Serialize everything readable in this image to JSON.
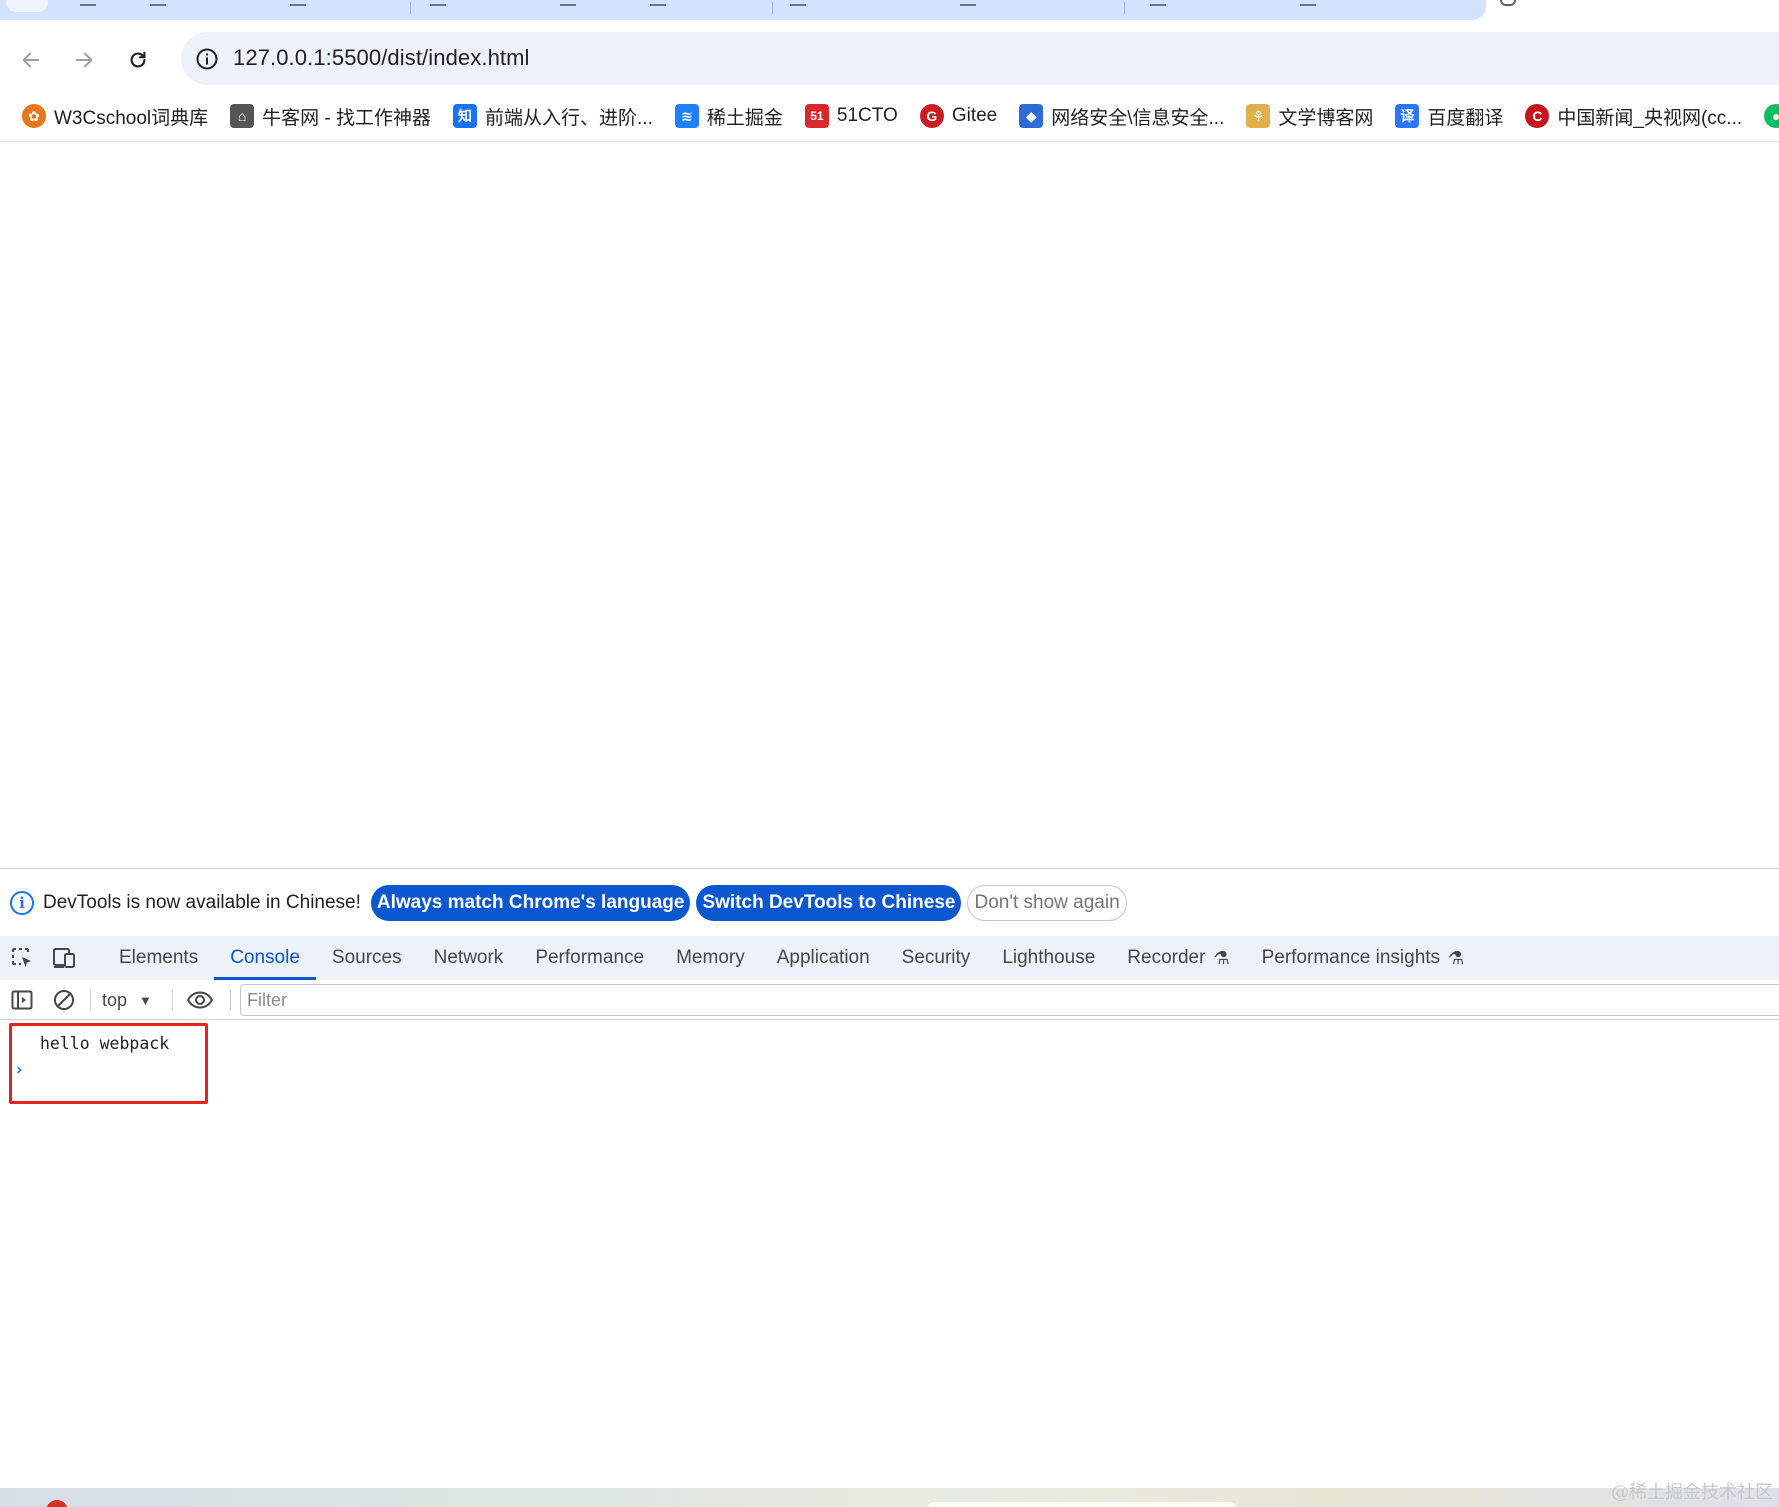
{
  "browser": {
    "url": "127.0.0.1:5500/dist/index.html"
  },
  "bookmarks": [
    {
      "label": "W3Cschool词典库",
      "icon": "w3cschool-icon",
      "color": "#e8761d"
    },
    {
      "label": "牛客网 - 找工作神器",
      "icon": "nowcoder-icon",
      "color": "#555555"
    },
    {
      "label": "前端从入行、进阶...",
      "icon": "zhihu-icon",
      "color": "#1772f6"
    },
    {
      "label": "稀土掘金",
      "icon": "juejin-icon",
      "color": "#1e80ff"
    },
    {
      "label": "51CTO",
      "icon": "51cto-icon",
      "color": "#d8282b"
    },
    {
      "label": "Gitee",
      "icon": "gitee-icon",
      "color": "#c71d23"
    },
    {
      "label": "网络安全\\信息安全...",
      "icon": "shield-icon",
      "color": "#2e6bd9"
    },
    {
      "label": "文学博客网",
      "icon": "wenxue-icon",
      "color": "#e2b04a"
    },
    {
      "label": "百度翻译",
      "icon": "baidu-translate-icon",
      "color": "#2b78f6"
    },
    {
      "label": "中国新闻_央视网(cc...",
      "icon": "cctv-icon",
      "color": "#c4161c"
    },
    {
      "label": "",
      "icon": "wechat-icon",
      "color": "#07c160"
    }
  ],
  "devtools": {
    "infobar": {
      "message": "DevTools is now available in Chinese!",
      "btn_match": "Always match Chrome's language",
      "btn_switch": "Switch DevTools to Chinese",
      "btn_dismiss": "Don't show again"
    },
    "tabs": [
      {
        "label": "Elements",
        "active": false,
        "experimental": false
      },
      {
        "label": "Console",
        "active": true,
        "experimental": false
      },
      {
        "label": "Sources",
        "active": false,
        "experimental": false
      },
      {
        "label": "Network",
        "active": false,
        "experimental": false
      },
      {
        "label": "Performance",
        "active": false,
        "experimental": false
      },
      {
        "label": "Memory",
        "active": false,
        "experimental": false
      },
      {
        "label": "Application",
        "active": false,
        "experimental": false
      },
      {
        "label": "Security",
        "active": false,
        "experimental": false
      },
      {
        "label": "Lighthouse",
        "active": false,
        "experimental": false
      },
      {
        "label": "Recorder",
        "active": false,
        "experimental": true
      },
      {
        "label": "Performance insights",
        "active": false,
        "experimental": true
      }
    ],
    "console": {
      "context": "top",
      "filter_placeholder": "Filter",
      "messages": [
        "hello webpack"
      ],
      "prompt": "›"
    },
    "accent": "#0b57d0",
    "highlight_color": "#e8211c"
  },
  "watermark": "@稀土掘金技术社区"
}
